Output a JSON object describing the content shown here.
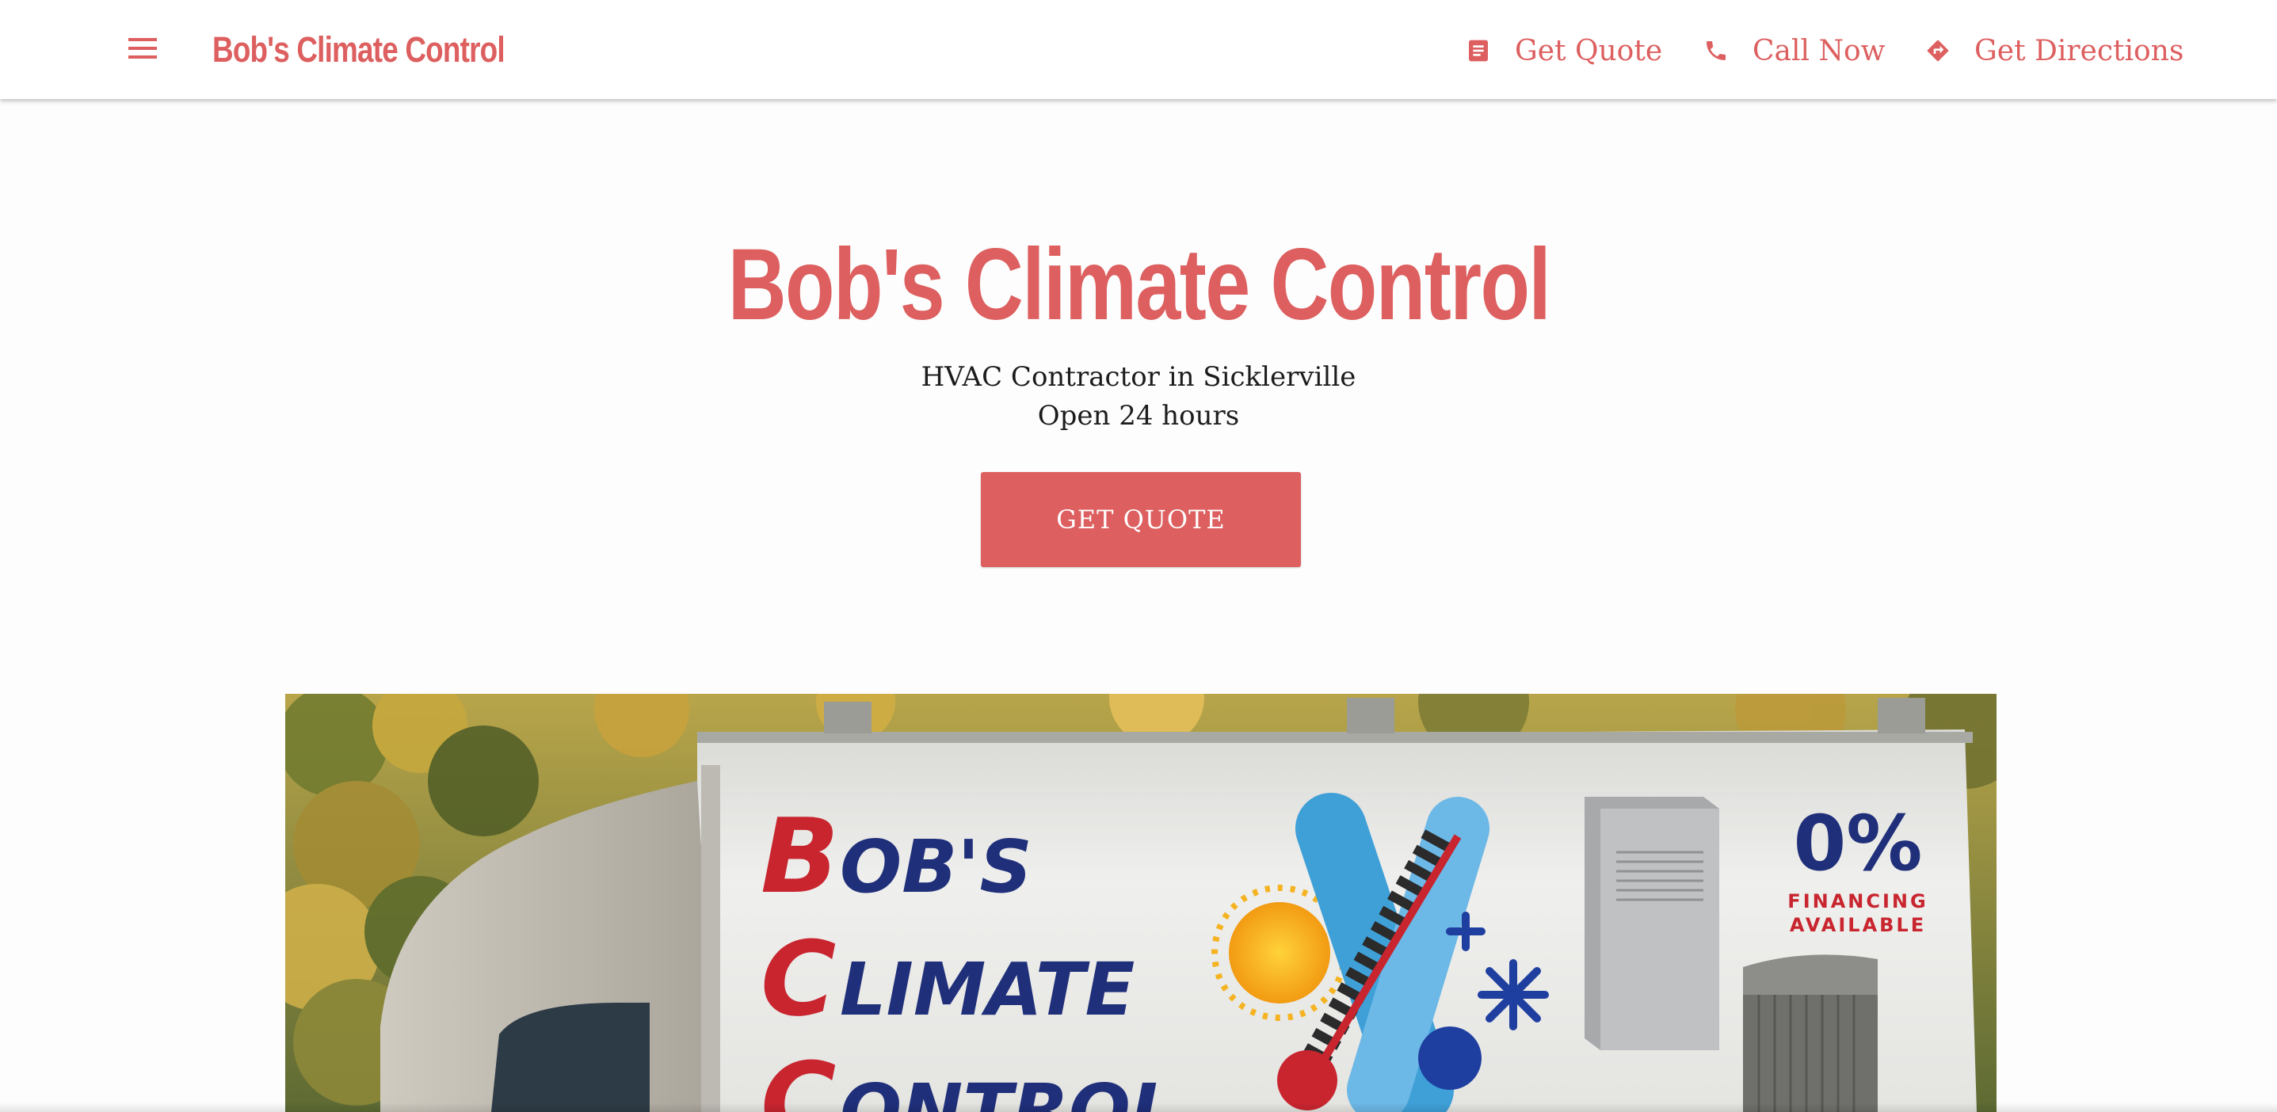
{
  "header": {
    "brand": "Bob's Climate Control",
    "menu_icon": "hamburger-menu-icon",
    "nav": [
      {
        "label": "Get Quote",
        "icon": "document-icon"
      },
      {
        "label": "Call Now",
        "icon": "phone-icon"
      },
      {
        "label": "Get Directions",
        "icon": "directions-icon"
      }
    ]
  },
  "hero": {
    "title": "Bob's Climate Control",
    "subtitle_line1": "HVAC Contractor in Sicklerville",
    "subtitle_line2": "Open 24 hours",
    "cta_label": "GET QUOTE"
  },
  "photo": {
    "truck_text": {
      "word1": "BOB'S",
      "word2": "CLIMATE",
      "word3": "CONTROL"
    },
    "financing_percent": "0%",
    "financing_line1": "FINANCING",
    "financing_line2": "AVAILABLE"
  },
  "colors": {
    "accent": "#dd5f5f",
    "text": "#1c1c1c",
    "background": "#fdfdfd"
  }
}
